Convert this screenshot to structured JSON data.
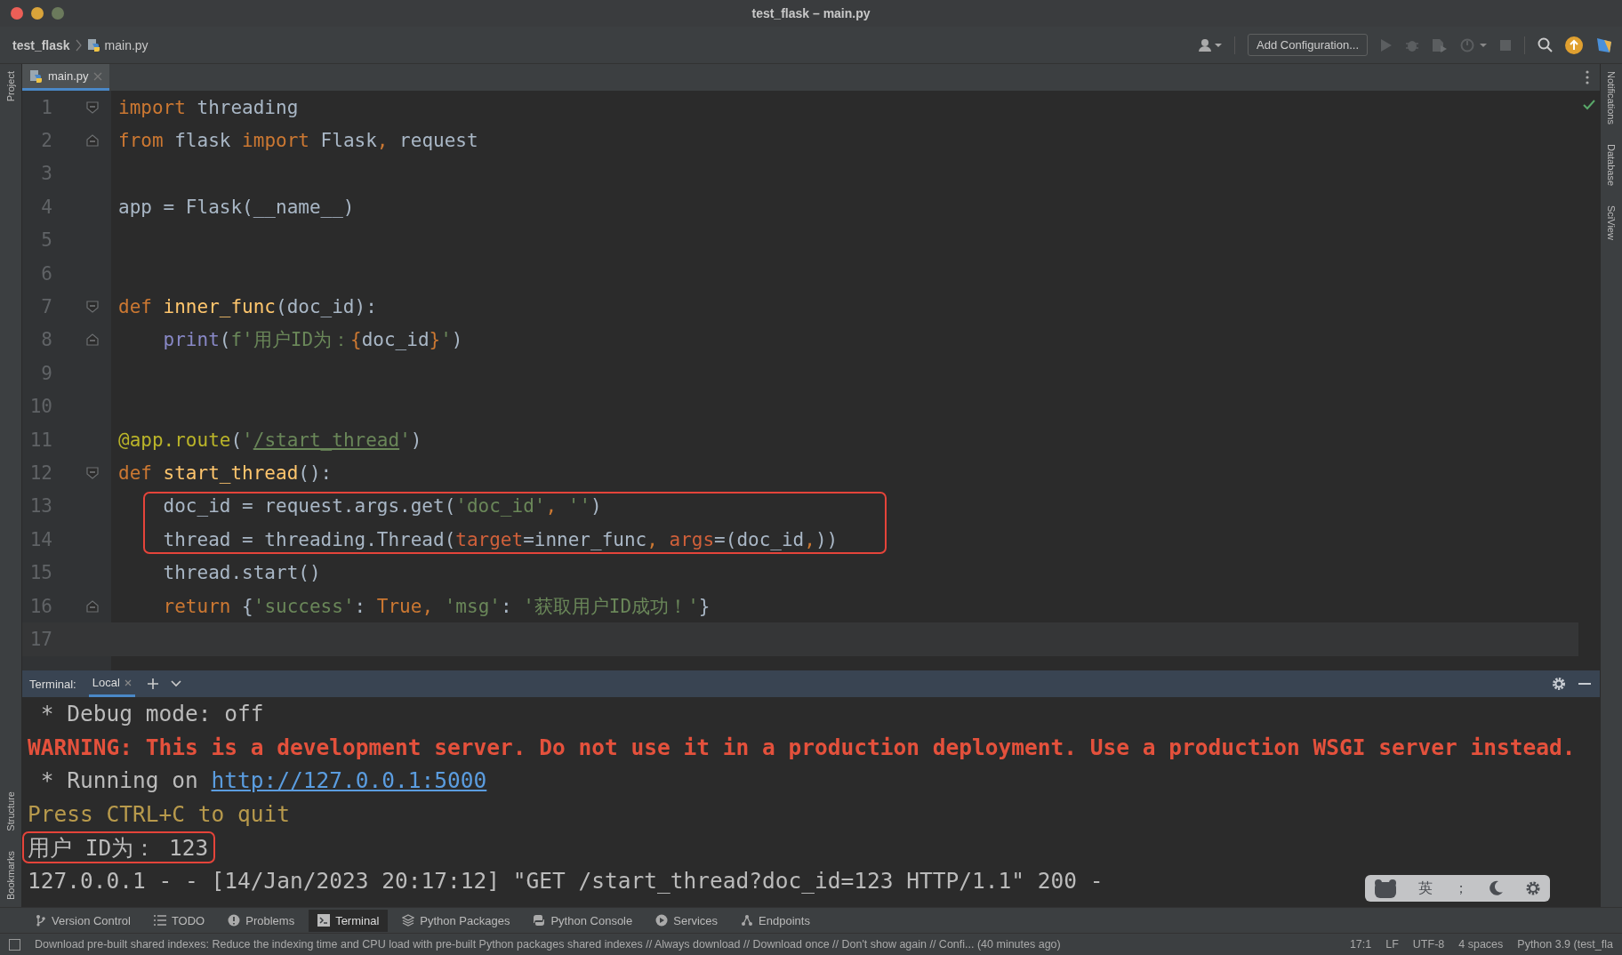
{
  "window": {
    "title": "test_flask – main.py"
  },
  "breadcrumb": [
    {
      "label": "test_flask",
      "kind": "project"
    },
    {
      "label": "main.py",
      "kind": "file"
    }
  ],
  "toolbar": {
    "config_button": "Add Configuration...",
    "actions": [
      {
        "kind": "run",
        "disabled": true
      },
      {
        "kind": "debug",
        "disabled": true
      },
      {
        "kind": "coverage",
        "disabled": true
      },
      {
        "kind": "profile",
        "disabled": true
      },
      {
        "kind": "stop",
        "disabled": true
      }
    ]
  },
  "left_stripe": {
    "top": [
      "Project"
    ],
    "bottom": [
      "Structure",
      "Bookmarks"
    ]
  },
  "right_stripe": [
    "Notifications",
    "Database",
    "SciView"
  ],
  "editor_tabs": [
    {
      "label": "main.py",
      "selected": true
    }
  ],
  "code_lines": [
    {
      "number": "1",
      "kind": "fold-start",
      "highlighted": false,
      "tokens": [
        {
          "text": "import",
          "kind": "kw"
        },
        {
          "text": " threading",
          "kind": "plain"
        }
      ]
    },
    {
      "number": "2",
      "kind": "fold-end",
      "highlighted": false,
      "tokens": [
        {
          "text": "from",
          "kind": "kw"
        },
        {
          "text": " flask ",
          "kind": "plain"
        },
        {
          "text": "import",
          "kind": "kw"
        },
        {
          "text": " Flask",
          "kind": "plain"
        },
        {
          "text": ", ",
          "kind": "punct"
        },
        {
          "text": "request",
          "kind": "plain"
        }
      ]
    },
    {
      "number": "3",
      "kind": "plain",
      "highlighted": false
    },
    {
      "number": "4",
      "kind": "plain",
      "highlighted": false,
      "tokens": [
        {
          "text": "app = Flask(__name__)",
          "kind": "plain"
        }
      ]
    },
    {
      "number": "5",
      "kind": "plain",
      "highlighted": false
    },
    {
      "number": "6",
      "kind": "plain",
      "highlighted": false
    },
    {
      "number": "7",
      "kind": "fold-start",
      "highlighted": false,
      "tokens": [
        {
          "text": "def ",
          "kind": "kw"
        },
        {
          "text": "inner_func",
          "kind": "fn"
        },
        {
          "text": "(doc_id):",
          "kind": "plain"
        }
      ]
    },
    {
      "number": "8",
      "kind": "fold-end",
      "highlighted": false,
      "tokens": [
        {
          "text": "    print",
          "kind": "builtin"
        },
        {
          "text": "(",
          "kind": "plain"
        },
        {
          "text": "f'用户ID为：",
          "kind": "str"
        },
        {
          "text": "{",
          "kind": "punct"
        },
        {
          "text": "doc_id",
          "kind": "plain"
        },
        {
          "text": "}",
          "kind": "punct"
        },
        {
          "text": "'",
          "kind": "str"
        },
        {
          "text": ")",
          "kind": "plain"
        }
      ]
    },
    {
      "number": "9",
      "kind": "plain",
      "highlighted": false
    },
    {
      "number": "10",
      "kind": "plain",
      "highlighted": false
    },
    {
      "number": "11",
      "kind": "plain",
      "highlighted": false,
      "tokens": [
        {
          "text": "@app.route",
          "kind": "dec"
        },
        {
          "text": "(",
          "kind": "plain"
        },
        {
          "text": "'",
          "kind": "str"
        },
        {
          "text": "/start_thread",
          "kind": "link"
        },
        {
          "text": "'",
          "kind": "str"
        },
        {
          "text": ")",
          "kind": "plain"
        }
      ]
    },
    {
      "number": "12",
      "kind": "fold-start",
      "highlighted": false,
      "tokens": [
        {
          "text": "def ",
          "kind": "kw"
        },
        {
          "text": "start_thread",
          "kind": "fn"
        },
        {
          "text": "():",
          "kind": "plain"
        }
      ]
    },
    {
      "number": "13",
      "kind": "plain",
      "highlighted": true,
      "tokens": [
        {
          "text": "    doc_id = request.args.get(",
          "kind": "plain"
        },
        {
          "text": "'doc_id'",
          "kind": "str"
        },
        {
          "text": ", ",
          "kind": "punct"
        },
        {
          "text": "''",
          "kind": "str"
        },
        {
          "text": ")",
          "kind": "plain"
        }
      ]
    },
    {
      "number": "14",
      "kind": "plain",
      "highlighted": true,
      "tokens": [
        {
          "text": "    thread = threading.Thread(",
          "kind": "plain"
        },
        {
          "text": "target",
          "kind": "param"
        },
        {
          "text": "=inner_func",
          "kind": "plain"
        },
        {
          "text": ", ",
          "kind": "punct"
        },
        {
          "text": "args",
          "kind": "param"
        },
        {
          "text": "=(doc_id",
          "kind": "plain"
        },
        {
          "text": ",",
          "kind": "punct"
        },
        {
          "text": "))",
          "kind": "plain"
        }
      ]
    },
    {
      "number": "15",
      "kind": "plain",
      "highlighted": false,
      "tokens": [
        {
          "text": "    thread.start()",
          "kind": "plain"
        }
      ]
    },
    {
      "number": "16",
      "kind": "fold-end",
      "highlighted": false,
      "tokens": [
        {
          "text": "    return",
          "kind": "kw"
        },
        {
          "text": " {",
          "kind": "plain"
        },
        {
          "text": "'success'",
          "kind": "str"
        },
        {
          "text": ": ",
          "kind": "plain"
        },
        {
          "text": "True",
          "kind": "kw"
        },
        {
          "text": ", ",
          "kind": "punct"
        },
        {
          "text": "'msg'",
          "kind": "str"
        },
        {
          "text": ": ",
          "kind": "plain"
        },
        {
          "text": "'获取用户ID成功！'",
          "kind": "str"
        },
        {
          "text": "}",
          "kind": "plain"
        }
      ]
    },
    {
      "number": "17",
      "kind": "plain",
      "current": true,
      "highlighted": false
    }
  ],
  "terminal": {
    "label": "Terminal:",
    "tabs": [
      {
        "label": "Local",
        "selected": true
      }
    ],
    "lines": [
      {
        "highlighted": false,
        "segments": [
          {
            "text": " * Debug mode: off",
            "kind": "plain"
          }
        ]
      },
      {
        "highlighted": false,
        "segments": [
          {
            "text": "WARNING: This is a development server. Do not use it in a production deployment. Use a production WSGI server instead.",
            "kind": "warning"
          }
        ]
      },
      {
        "highlighted": false,
        "segments": [
          {
            "text": " * Running on ",
            "kind": "plain"
          },
          {
            "text": "http://127.0.0.1:5000",
            "kind": "link"
          }
        ]
      },
      {
        "highlighted": false,
        "segments": [
          {
            "text": "Press CTRL+C to quit",
            "kind": "hint"
          }
        ]
      },
      {
        "highlighted": true,
        "segments": [
          {
            "text": "用户 ID为： 123",
            "kind": "plain"
          }
        ]
      },
      {
        "highlighted": false,
        "segments": [
          {
            "text": "127.0.0.1 - - [14/Jan/2023 20:17:12] \"GET /start_thread?doc_id=123 HTTP/1.1\" 200 -",
            "kind": "plain"
          }
        ]
      }
    ]
  },
  "ime_toolbar": [
    {
      "kind": "logo"
    },
    {
      "kind": "text",
      "label": "英"
    },
    {
      "kind": "text",
      "label": "；"
    },
    {
      "kind": "moon"
    },
    {
      "kind": "gear"
    }
  ],
  "tool_windows": [
    {
      "label": "Version Control",
      "kind": "branch",
      "selected": false
    },
    {
      "label": "TODO",
      "kind": "list",
      "selected": false
    },
    {
      "label": "Problems",
      "kind": "problems",
      "selected": false
    },
    {
      "label": "Terminal",
      "kind": "terminal",
      "selected": true
    },
    {
      "label": "Python Packages",
      "kind": "packages",
      "selected": false
    },
    {
      "label": "Python Console",
      "kind": "console",
      "selected": false
    },
    {
      "label": "Services",
      "kind": "services",
      "selected": false
    },
    {
      "label": "Endpoints",
      "kind": "endpoints",
      "selected": false
    }
  ],
  "status_bar": {
    "message": "Download pre-built shared indexes: Reduce the indexing time and CPU load with pre-built Python packages shared indexes // Always download // Download once // Don't show again // Confi... (40 minutes ago)",
    "items": [
      "17:1",
      "LF",
      "UTF-8",
      "4 spaces",
      "Python 3.9 (test_fla"
    ]
  }
}
